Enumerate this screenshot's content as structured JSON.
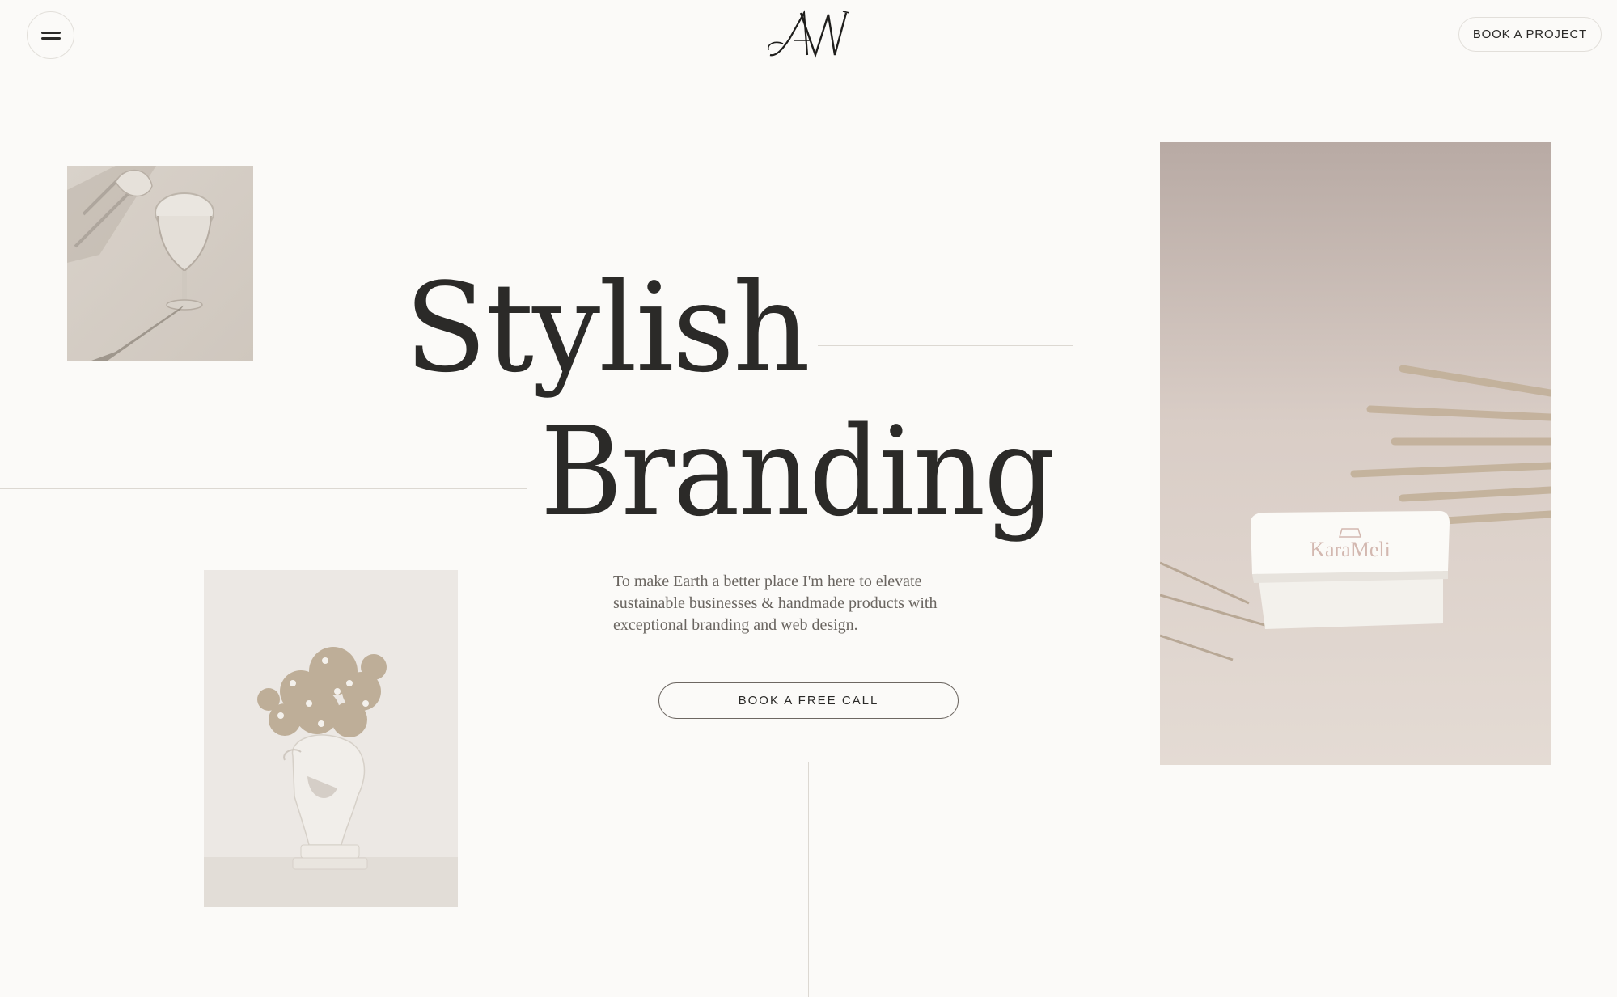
{
  "header": {
    "menu_icon": "hamburger-menu-icon",
    "logo_text": "AW",
    "book_project_label": "BOOK A PROJECT"
  },
  "hero": {
    "headline_line1": "Stylish",
    "headline_line2": "Branding",
    "intro": "To make Earth a better place I'm here to elevate sustainable businesses & handmade products with exceptional branding and web design.",
    "cta_label": "BOOK A FREE CALL"
  },
  "images": {
    "top_left": "glass-photo",
    "bottom_left": "vase-flowers-photo",
    "right": "jewelry-box-photo",
    "box_label": "KaraMeli"
  },
  "colors": {
    "background": "#fbfaf8",
    "text": "#2b2a28",
    "muted_text": "#6a6560",
    "line": "#dcd8d2"
  }
}
